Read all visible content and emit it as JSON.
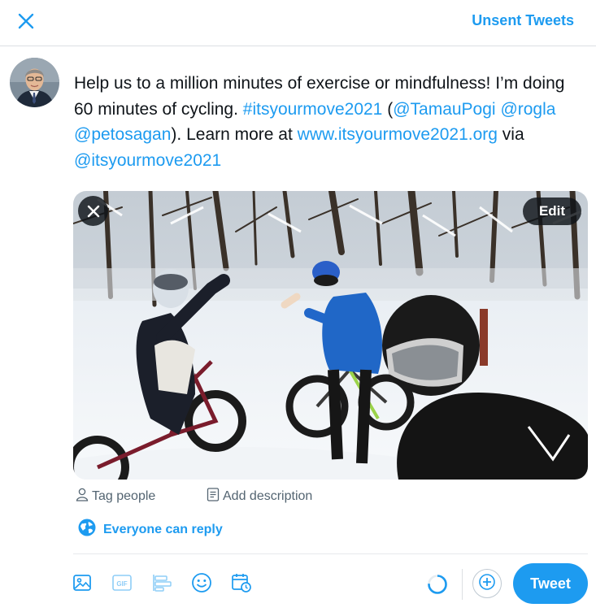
{
  "header": {
    "unsent_label": "Unsent Tweets"
  },
  "composer": {
    "text_segments": [
      {
        "text": "Help us to a million minutes of exercise or mindfulness! I’m doing 60 minutes of cycling. ",
        "link": false
      },
      {
        "text": "#itsyourmove2021",
        "link": true
      },
      {
        "text": " (",
        "link": false
      },
      {
        "text": "@TamauPogi",
        "link": true
      },
      {
        "text": " ",
        "link": false
      },
      {
        "text": "@rogla",
        "link": true
      },
      {
        "text": " ",
        "link": false
      },
      {
        "text": "@petosagan",
        "link": true
      },
      {
        "text": "). Learn more at ",
        "link": false
      },
      {
        "text": "www.itsyourmove2021.org",
        "link": true
      },
      {
        "text": " via ",
        "link": false
      },
      {
        "text": "@itsyourmove2021",
        "link": true
      }
    ]
  },
  "media": {
    "edit_label": "Edit",
    "tag_people_label": "Tag people",
    "add_description_label": "Add description"
  },
  "reply": {
    "label": "Everyone can reply"
  },
  "toolbar": {
    "tweet_label": "Tweet",
    "icons": [
      "image-icon",
      "gif-icon",
      "poll-icon",
      "emoji-icon",
      "schedule-icon"
    ]
  },
  "colors": {
    "accent": "#1d9bf0",
    "text": "#0f1419",
    "muted": "#536471"
  }
}
